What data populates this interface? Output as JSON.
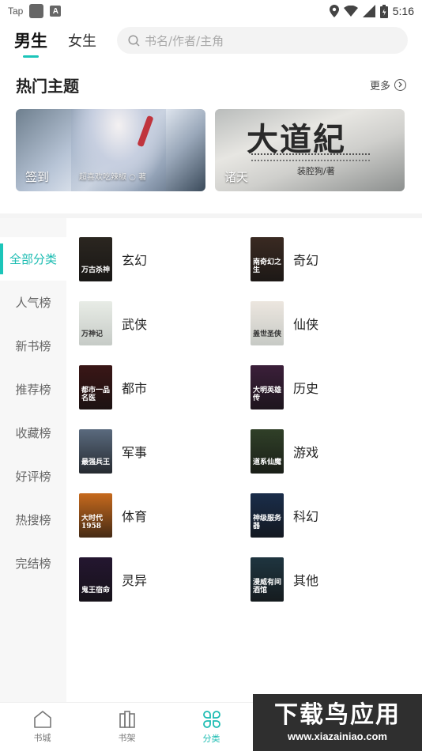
{
  "status_bar": {
    "app_tag": "Tap",
    "time": "5:16",
    "icons": [
      "location-icon",
      "wifi-icon",
      "signal-icon",
      "battery-icon"
    ]
  },
  "header": {
    "tabs": [
      {
        "label": "男生",
        "active": true
      },
      {
        "label": "女生",
        "active": false
      }
    ],
    "search_placeholder": "书名/作者/主角",
    "accent_color": "#1cc5b9"
  },
  "hot_topics": {
    "title": "热门主题",
    "more_label": "更多",
    "banners": [
      {
        "label": "签到",
        "subtitle": "超喜欢吃辣椒 ○ 著"
      },
      {
        "label": "诸天",
        "calligraphy": "大道紀",
        "subtitle": "装腔狗/著"
      }
    ]
  },
  "category_nav": {
    "items": [
      {
        "label": "全部分类",
        "active": true
      },
      {
        "label": "人气榜",
        "active": false
      },
      {
        "label": "新书榜",
        "active": false
      },
      {
        "label": "推荐榜",
        "active": false
      },
      {
        "label": "收藏榜",
        "active": false
      },
      {
        "label": "好评榜",
        "active": false
      },
      {
        "label": "热搜榜",
        "active": false
      },
      {
        "label": "完结榜",
        "active": false
      }
    ]
  },
  "categories": [
    {
      "label": "玄幻",
      "cover_text": "万古杀神",
      "cover_color": "#2b2620"
    },
    {
      "label": "奇幻",
      "cover_text": "南奇幻之生",
      "cover_color": "#3a2a22"
    },
    {
      "label": "武侠",
      "cover_text": "万神记",
      "cover_color": "#e8ece6"
    },
    {
      "label": "仙侠",
      "cover_text": "盖世圣侠",
      "cover_color": "#ece6df"
    },
    {
      "label": "都市",
      "cover_text": "都市一品名医",
      "cover_color": "#3a1616"
    },
    {
      "label": "历史",
      "cover_text": "大明英雄传",
      "cover_color": "#3b1f3a"
    },
    {
      "label": "军事",
      "cover_text": "最强兵王",
      "cover_color": "#5a6a7e"
    },
    {
      "label": "游戏",
      "cover_text": "道系仙魔",
      "cover_color": "#304028"
    },
    {
      "label": "体育",
      "cover_text": "大时代1958",
      "cover_color": "#c76a1d"
    },
    {
      "label": "科幻",
      "cover_text": "神级服务器",
      "cover_color": "#1a2d4a"
    },
    {
      "label": "灵异",
      "cover_text": "鬼王宿命",
      "cover_color": "#241630"
    },
    {
      "label": "其他",
      "cover_text": "漫威有间酒馆",
      "cover_color": "#1f3540"
    }
  ],
  "bottom_nav": {
    "items": [
      {
        "label": "书城",
        "icon": "home-icon",
        "active": false
      },
      {
        "label": "书架",
        "icon": "bookshelf-icon",
        "active": false
      },
      {
        "label": "分类",
        "icon": "category-icon",
        "active": true
      }
    ]
  },
  "watermark": {
    "title": "下载鸟应用",
    "url": "www.xiazainiao.com"
  }
}
